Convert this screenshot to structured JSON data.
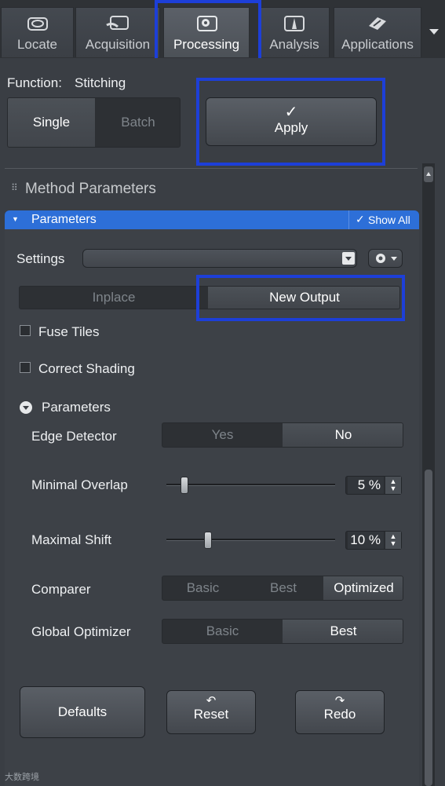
{
  "tabs": [
    {
      "label": "Locate",
      "icon": "eye-icon"
    },
    {
      "label": "Acquisition",
      "icon": "camera-icon"
    },
    {
      "label": "Processing",
      "icon": "gear-icon"
    },
    {
      "label": "Analysis",
      "icon": "histogram-icon"
    },
    {
      "label": "Applications",
      "icon": "apps-icon"
    }
  ],
  "function": {
    "label": "Function:",
    "value": "Stitching"
  },
  "mode": {
    "single": "Single",
    "batch": "Batch"
  },
  "apply": {
    "check": "✓",
    "label": "Apply"
  },
  "section": {
    "title": "Method Parameters"
  },
  "parameters_header": {
    "title": "Parameters",
    "show_all": "Show All"
  },
  "settings": {
    "label": "Settings",
    "value": ""
  },
  "output": {
    "inplace": "Inplace",
    "new_output": "New Output"
  },
  "checkboxes": {
    "fuse_tiles": "Fuse Tiles",
    "correct_shading": "Correct Shading"
  },
  "sub_parameters": {
    "title": "Parameters"
  },
  "edge_detector": {
    "label": "Edge Detector",
    "yes": "Yes",
    "no": "No"
  },
  "minimal_overlap": {
    "label": "Minimal Overlap",
    "value": "5 %",
    "slider_fraction": 0.1
  },
  "maximal_shift": {
    "label": "Maximal Shift",
    "value": "10 %",
    "slider_fraction": 0.24
  },
  "comparer": {
    "label": "Comparer",
    "basic": "Basic",
    "best": "Best",
    "optimized": "Optimized"
  },
  "global_optimizer": {
    "label": "Global Optimizer",
    "basic": "Basic",
    "best": "Best"
  },
  "buttons": {
    "defaults": "Defaults",
    "reset": "Reset",
    "redo": "Redo",
    "reset_icon": "↶",
    "redo_icon": "↷"
  },
  "watermark": "大数跨境",
  "colors": {
    "accent_blue": "#2d6fd8",
    "highlight_box": "#1d3fd8"
  }
}
